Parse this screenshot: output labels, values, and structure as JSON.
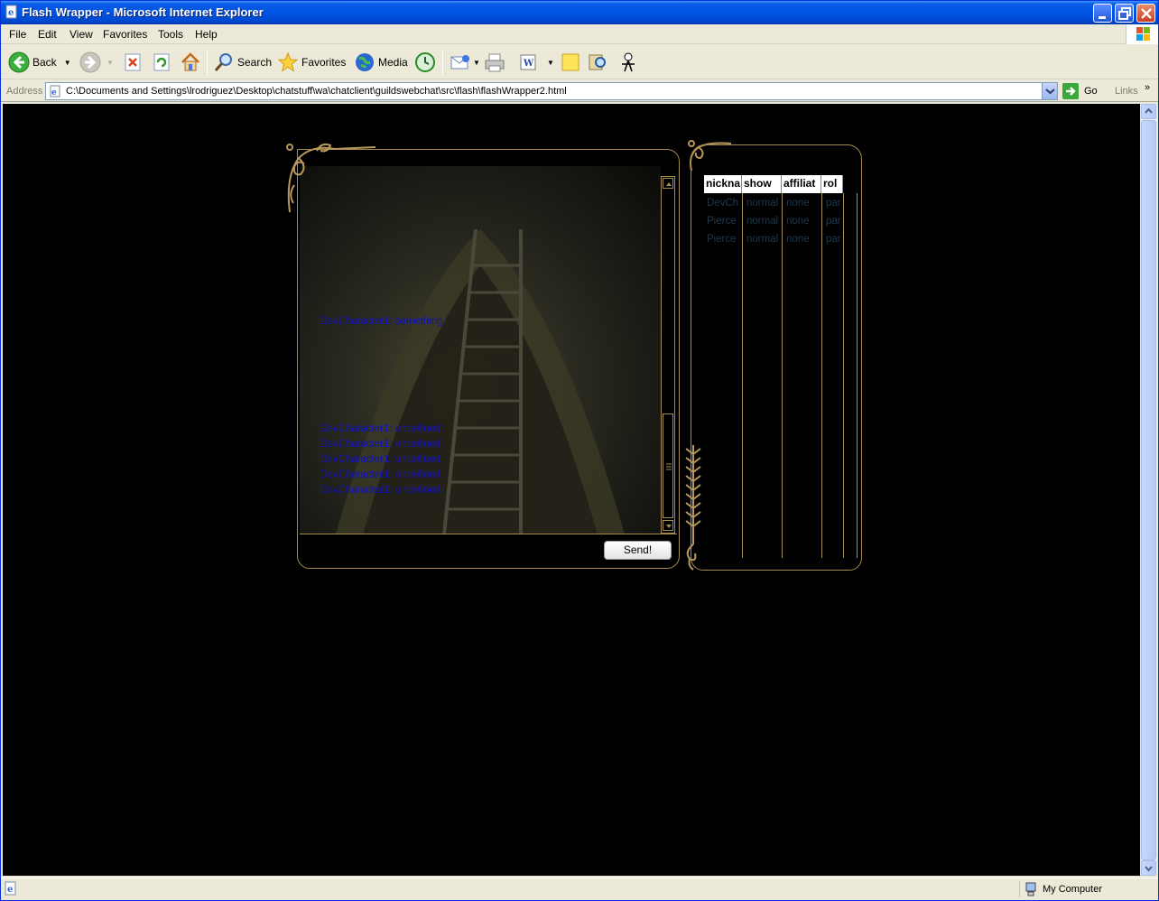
{
  "window": {
    "title": "Flash Wrapper - Microsoft Internet Explorer"
  },
  "menu": {
    "items": [
      "File",
      "Edit",
      "View",
      "Favorites",
      "Tools",
      "Help"
    ]
  },
  "toolbar": {
    "back_label": "Back",
    "search_label": "Search",
    "favorites_label": "Favorites",
    "media_label": "Media"
  },
  "address": {
    "label": "Address",
    "url": "C:\\Documents and Settings\\lrodriguez\\Desktop\\chatstuff\\wa\\chatclient\\guildswebchat\\src\\flash\\flashWrapper2.html",
    "go_label": "Go",
    "links_label": "Links"
  },
  "chat": {
    "messages": [
      "DevCharacter1: something",
      "DevCharacter1: undefined",
      "DevCharacter1: undefined",
      "DevCharacter1: undefined",
      "DevCharacter1: undefined",
      "DevCharacter1: undefined"
    ],
    "send_label": "Send!"
  },
  "roster": {
    "columns": [
      "nickname",
      "show",
      "affiliation",
      "role"
    ],
    "column_display": [
      "nickna",
      "show",
      "affiliat",
      "rol"
    ],
    "rows": [
      [
        "DevCh",
        "normal",
        "none",
        "par"
      ],
      [
        "Pierce",
        "normal",
        "none",
        "par"
      ],
      [
        "Pierce",
        "normal",
        "none",
        "par"
      ]
    ]
  },
  "status": {
    "zone": "My Computer"
  },
  "colors": {
    "gold": "#a58a52",
    "chat_text": "#1010c0",
    "xp_blue": "#0054e3"
  }
}
